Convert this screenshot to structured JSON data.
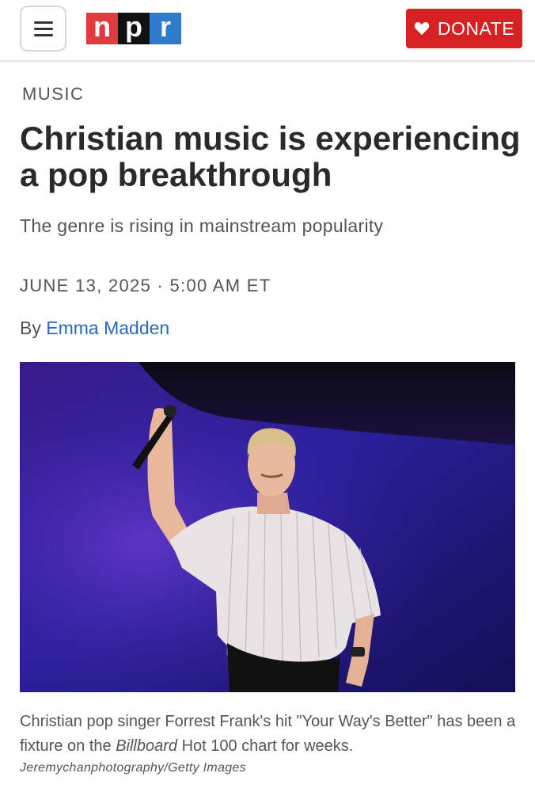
{
  "header": {
    "menu_icon": "hamburger-menu-icon",
    "logo_letters": [
      "n",
      "p",
      "r"
    ],
    "logo_colors": [
      "#e03a3e",
      "#111111",
      "#2d7dcc"
    ],
    "donate_label": "DONATE",
    "donate_icon": "heart-icon",
    "donate_color": "#d62021"
  },
  "article": {
    "section": "MUSIC",
    "headline": "Christian music is experiencing a pop breakthrough",
    "subheadline": "The genre is rising in mainstream popularity",
    "dateline": "JUNE 13, 2025 · 5:00 AM ET",
    "byline_prefix": "By",
    "author": "Emma Madden",
    "author_color": "#2a6bbd",
    "image": {
      "caption_part1": "Christian pop singer Forrest Frank's hit \"Your Way's Better\" has been a fixture on the ",
      "caption_italic": "Billboard",
      "caption_part2": " Hot 100 chart for weeks.",
      "credit": "Jeremychanphotography/Getty Images"
    }
  }
}
